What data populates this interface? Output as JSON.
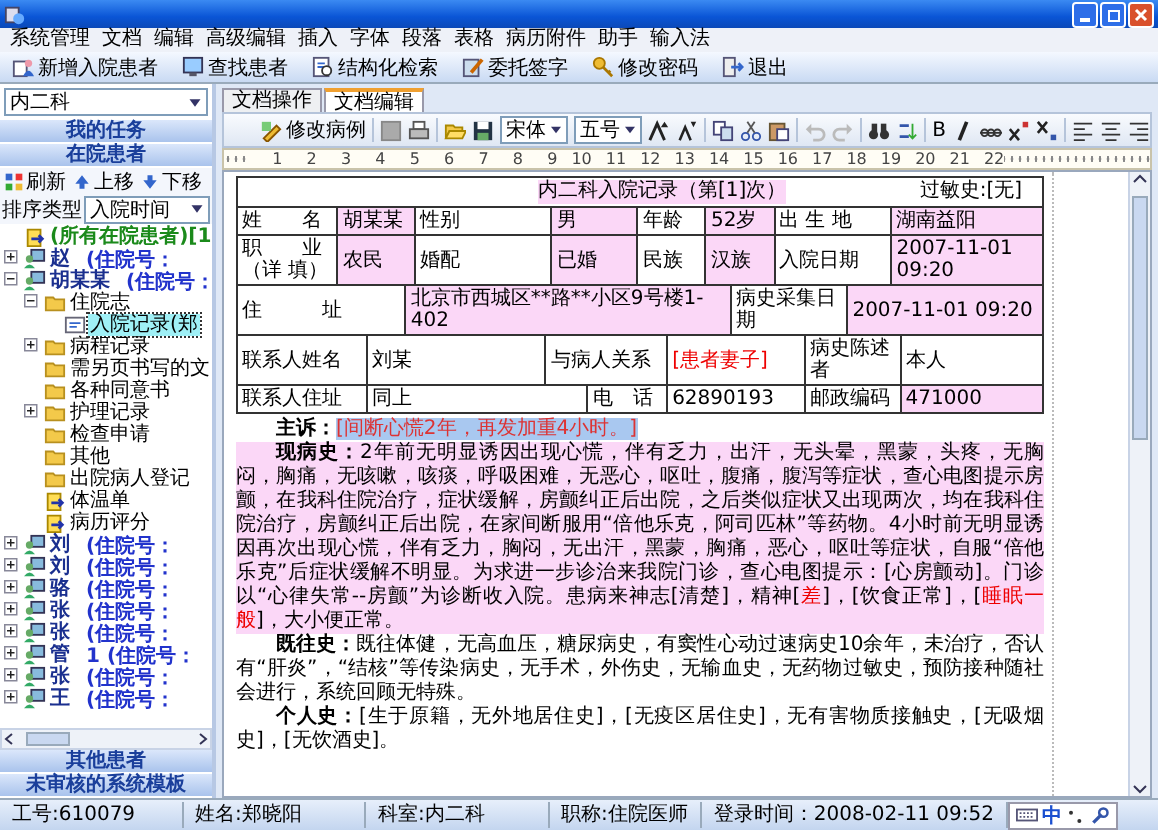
{
  "menu": [
    "系统管理",
    "文档",
    "编辑",
    "高级编辑",
    "插入",
    "字体",
    "段落",
    "表格",
    "病历附件",
    "助手",
    "输入法"
  ],
  "toolbar": [
    {
      "label": "新增入院患者",
      "kind": "add-patient"
    },
    {
      "label": "查找患者",
      "kind": "find"
    },
    {
      "label": "结构化检索",
      "kind": "search"
    },
    {
      "label": "委托签字",
      "kind": "sign"
    },
    {
      "label": "修改密码",
      "kind": "key"
    },
    {
      "label": "退出",
      "kind": "exit"
    }
  ],
  "sidebar": {
    "department": "内二科",
    "top_sections": [
      "我的任务",
      "在院患者"
    ],
    "actions": [
      {
        "label": "刷新",
        "kind": "refresh"
      },
      {
        "label": "上移",
        "kind": "up"
      },
      {
        "label": "下移",
        "kind": "down"
      }
    ],
    "sort": {
      "label": "排序类型",
      "value": "入院时间"
    },
    "tree": [
      {
        "label": "(所有在院患者)[1",
        "kind": "all",
        "selected": false
      },
      {
        "label": "赵",
        "number": "(住院号：",
        "kind": "patient",
        "expanded": false,
        "selected": false
      },
      {
        "label": "胡某某",
        "number": "(住院号：",
        "kind": "patient",
        "expanded": true,
        "selected": false,
        "children": [
          {
            "label": "住院志",
            "kind": "folder",
            "expanded": true,
            "selected": false,
            "children": [
              {
                "label": "入院记录(郑",
                "kind": "record",
                "selected": true
              }
            ]
          },
          {
            "label": "病程记录",
            "kind": "folder",
            "expanded": false,
            "selected": false
          },
          {
            "label": "需另页书写的文",
            "kind": "folder",
            "selected": false
          },
          {
            "label": "各种同意书",
            "kind": "folder",
            "selected": false
          },
          {
            "label": "护理记录",
            "kind": "folder",
            "expanded": false,
            "selected": false
          },
          {
            "label": "检查申请",
            "kind": "folder",
            "selected": false
          },
          {
            "label": "其他",
            "kind": "folder",
            "selected": false
          },
          {
            "label": "出院病人登记",
            "kind": "folder",
            "selected": false
          },
          {
            "label": "体温单",
            "kind": "form",
            "selected": false
          },
          {
            "label": "病历评分",
            "kind": "form",
            "selected": false
          }
        ]
      },
      {
        "label": "刘",
        "number": "(住院号：",
        "kind": "patient",
        "expanded": false,
        "selected": false
      },
      {
        "label": "刘",
        "number": "(住院号：",
        "kind": "patient",
        "expanded": false,
        "selected": false
      },
      {
        "label": "骆",
        "number": "(住院号：",
        "kind": "patient",
        "expanded": false,
        "selected": false
      },
      {
        "label": "张",
        "number": "(住院号：",
        "kind": "patient",
        "expanded": false,
        "selected": false
      },
      {
        "label": "张",
        "number": "(住院号：",
        "kind": "patient",
        "expanded": false,
        "selected": false
      },
      {
        "label": "管",
        "number": "1 (住院号：",
        "kind": "patient",
        "expanded": false,
        "selected": false
      },
      {
        "label": "张",
        "number": "(住院号：",
        "kind": "patient",
        "expanded": false,
        "selected": false
      },
      {
        "label": "王",
        "number": "(住院号：",
        "kind": "patient",
        "expanded": false,
        "selected": false
      }
    ],
    "bottom_sections": [
      "其他患者",
      "未审核的系统模板"
    ]
  },
  "tabs": [
    {
      "label": "文档操作",
      "selected": false
    },
    {
      "label": "文档编辑",
      "selected": true
    }
  ],
  "editor_toolbar": {
    "edit_button": "修改病例",
    "font": "宋体",
    "size": "五号",
    "bold": "B"
  },
  "ruler": [
    "1",
    "2",
    "3",
    "4",
    "5",
    "6",
    "7",
    "8",
    "9",
    "10",
    "11",
    "12",
    "13",
    "14",
    "15",
    "16",
    "17",
    "18",
    "19",
    "20",
    "21",
    "22"
  ],
  "document": {
    "title": "内二科入院记录（第[1]次）",
    "allergy": "过敏史:[无]",
    "table": [
      [
        {
          "text": "姓　　名",
          "kind": "label"
        },
        {
          "text": "胡某某",
          "kind": "value"
        },
        {
          "text": "性别",
          "kind": "label"
        },
        {
          "text": "男",
          "kind": "value"
        },
        {
          "text": "年龄",
          "kind": "label"
        },
        {
          "text": "52岁",
          "kind": "value"
        },
        {
          "text": "出 生 地",
          "kind": "label"
        },
        {
          "text": "湖南益阳",
          "kind": "value"
        }
      ],
      [
        {
          "text": "职　　业（详 填）",
          "kind": "label"
        },
        {
          "text": "农民",
          "kind": "value"
        },
        {
          "text": "婚配",
          "kind": "label"
        },
        {
          "text": "已婚",
          "kind": "value"
        },
        {
          "text": "民族",
          "kind": "label"
        },
        {
          "text": "汉族",
          "kind": "value"
        },
        {
          "text": "入院日期",
          "kind": "label"
        },
        {
          "text": "2007-11-01 09:20",
          "kind": "value"
        }
      ],
      [
        {
          "text": "住　　　址",
          "kind": "label"
        },
        {
          "text": "北京市西城区**路**小区9号楼1-402",
          "kind": "value"
        },
        {
          "text": "病史采集日期",
          "kind": "label"
        },
        {
          "text": "2007-11-01 09:20",
          "kind": "value"
        }
      ],
      [
        {
          "text": "联系人姓名",
          "kind": "label"
        },
        {
          "text": "刘某",
          "kind": "plain"
        },
        {
          "text": "与病人关系",
          "kind": "label"
        },
        {
          "text": "[患者妻子]",
          "kind": "red"
        },
        {
          "text": "病史陈述者",
          "kind": "label"
        },
        {
          "text": "本人",
          "kind": "plain"
        }
      ],
      [
        {
          "text": "联系人住址",
          "kind": "label"
        },
        {
          "text": "同上",
          "kind": "plain"
        },
        {
          "text": "电　话",
          "kind": "label"
        },
        {
          "text": "62890193",
          "kind": "plain"
        },
        {
          "text": "邮政编码",
          "kind": "label"
        },
        {
          "text": "471000",
          "kind": "value"
        }
      ]
    ],
    "paragraphs": [
      {
        "label": "主诉：",
        "highlighted": false,
        "segments": [
          {
            "text": "[间断心慌2年，再发加重4小时。]",
            "kind": "selected"
          }
        ]
      },
      {
        "label": "现病史：",
        "highlighted": true,
        "segments": [
          {
            "text": "2年前无明显诱因出现心慌，伴有乏力，出汗，无头晕，黑蒙，头疼，无胸闷，胸痛，无咳嗽，咳痰，呼吸困难，无恶心，呕吐，腹痛，腹泻等症状，查心电图提示房颤，在我科住院治疗，症状缓解，房颤纠正后出院，之后类似症状又出现两次，均在我科住院治疗，房颤纠正后出院，在家间断服用“倍他乐克，阿司匹林”等药物。4小时前无明显诱因再次出现心慌，伴有乏力，胸闷，无出汗，黑蒙，胸痛，恶心，呕吐等症状，自服“倍他乐克”后症状缓解不明显。为求进一步诊治来我院门诊，查心电图提示：[心房颤动]。门诊以“心律失常--房颤”为诊断收入院。患病来神志[清楚]，精神[",
            "kind": "plain"
          },
          {
            "text": "差",
            "kind": "red"
          },
          {
            "text": "]，[饮食正常]，[",
            "kind": "plain"
          },
          {
            "text": "睡眠一般",
            "kind": "red"
          },
          {
            "text": "]，大小便正常。",
            "kind": "plain"
          }
        ]
      },
      {
        "label": "既往史：",
        "highlighted": false,
        "segments": [
          {
            "text": "既往体健，无高血压，糖尿病史，有窦性心动过速病史10余年，未治疗，否认有“肝炎”，“结核”等传染病史，无手术，外伤史，无输血史，无药物过敏史，预防接种随社会进行，系统回顾无特殊。",
            "kind": "plain"
          }
        ]
      },
      {
        "label": "个人史：",
        "highlighted": false,
        "segments": [
          {
            "text": "[生于原籍，无外地居住史]，[无疫区居住史]，无有害物质接触史，[无吸烟史]，[无饮酒史]。",
            "kind": "plain"
          }
        ]
      }
    ]
  },
  "status_bar": [
    "工号:610079",
    "姓名:郑晓阳",
    "科室:内二科",
    "职称:住院医师",
    "登录时间：2008-02-11 09:52"
  ],
  "ime": "中"
}
